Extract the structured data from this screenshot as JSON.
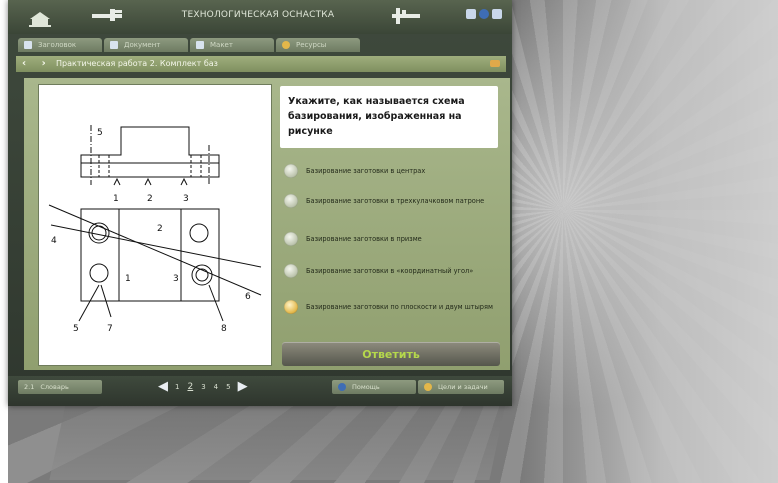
{
  "window": {
    "title": "ТЕХНОЛОГИЧЕСКАЯ ОСНАСТКА"
  },
  "tabs": [
    {
      "label": "Заголовок"
    },
    {
      "label": "Документ"
    },
    {
      "label": "Макет"
    },
    {
      "label": "Ресурсы"
    }
  ],
  "crumb": {
    "text": "Практическая работа 2. Комплект баз"
  },
  "question": {
    "text": "Укажите, как называется схема базирования, изображенная на рисунке"
  },
  "options": [
    {
      "label": "Базирование заготовки в центрах",
      "selected": false
    },
    {
      "label": "Базирование заготовки в трехкулачковом патроне",
      "selected": false
    },
    {
      "label": "Базирование заготовки в призме",
      "selected": false
    },
    {
      "label": "Базирование заготовки в «координатный угол»",
      "selected": false
    },
    {
      "label": "Базирование заготовки по плоскости и двум штырям",
      "selected": true
    }
  ],
  "answer_button": {
    "label": "Ответить"
  },
  "footer": {
    "left_label": "Словарь",
    "left_code": "2.1",
    "right_label_1": "Помощь",
    "right_label_2": "Цели и задачи",
    "pages": [
      "1",
      "2",
      "3",
      "4",
      "5"
    ],
    "current_page": "2"
  },
  "drawing": {
    "labels": [
      "5",
      "1",
      "2",
      "3",
      "2",
      "4",
      "1",
      "3",
      "6",
      "5",
      "7",
      "8"
    ]
  },
  "colors": {
    "accent_gold": "#e3b74a",
    "answer_text": "#b5d84c"
  }
}
